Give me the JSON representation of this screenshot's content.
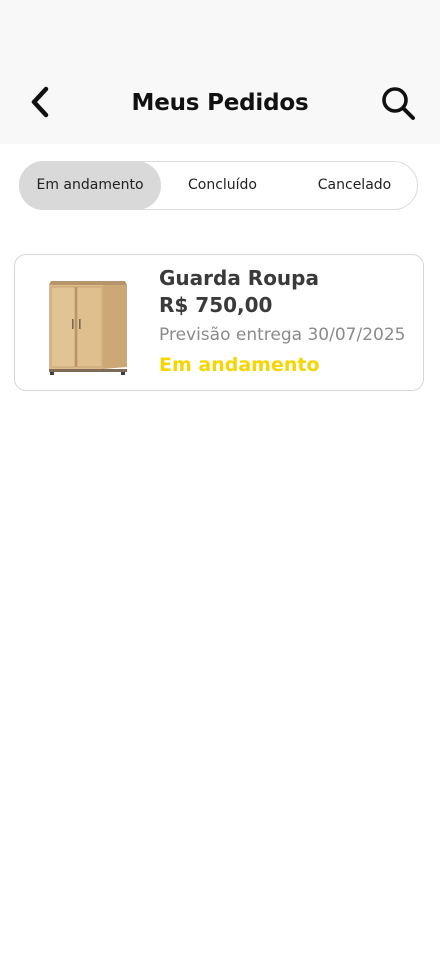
{
  "header": {
    "title": "Meus Pedidos",
    "back_icon": "chevron-left-icon",
    "search_icon": "search-icon"
  },
  "tabs": [
    {
      "label": "Em andamento",
      "active": true
    },
    {
      "label": "Concluído",
      "active": false
    },
    {
      "label": "Cancelado",
      "active": false
    }
  ],
  "orders": [
    {
      "name": "Guarda Roupa",
      "price": "R$ 750,00",
      "delivery_label": "Previsão entrega",
      "delivery_date": "30/07/2025",
      "status": "Em andamento",
      "image_icon": "wardrobe-icon"
    }
  ],
  "colors": {
    "header_bg": "#f8f8f8",
    "active_tab_bg": "#d9d9d9",
    "status_in_progress": "#f7d501",
    "text_primary": "#3a3a3a",
    "text_secondary": "#8a8a8a"
  }
}
